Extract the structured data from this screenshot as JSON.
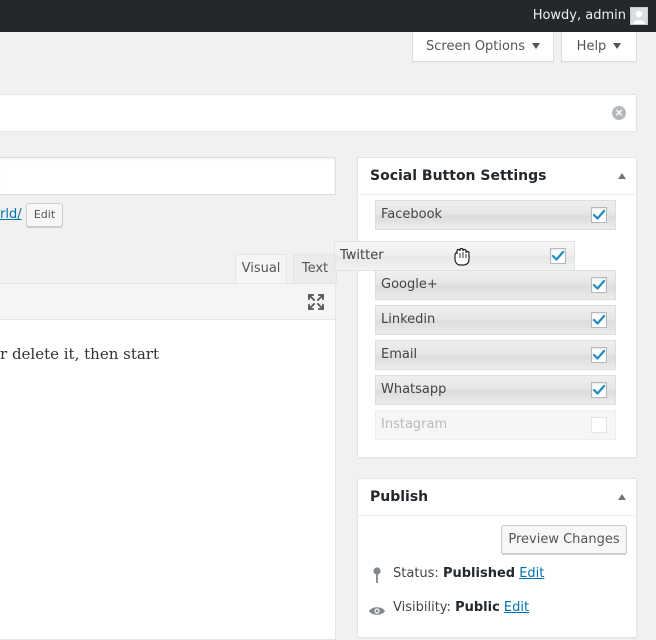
{
  "adminbar": {
    "howdy": "Howdy, admin"
  },
  "screen_meta": {
    "screen_options": "Screen Options",
    "help": "Help"
  },
  "notice": {
    "close_icon": "×"
  },
  "permalink": {
    "tail": "rld/",
    "edit_label": "Edit"
  },
  "editor": {
    "tabs": {
      "visual": "Visual",
      "text": "Text"
    },
    "content_fragment": "r delete it, then start"
  },
  "social_settings": {
    "title": "Social Button Settings",
    "items": [
      {
        "label": "Facebook",
        "checked": true,
        "enabled": true
      },
      {
        "label": "Twitter",
        "checked": true,
        "enabled": true,
        "dragging": true
      },
      {
        "label": "Google+",
        "checked": true,
        "enabled": true
      },
      {
        "label": "Linkedin",
        "checked": true,
        "enabled": true
      },
      {
        "label": "Email",
        "checked": true,
        "enabled": true
      },
      {
        "label": "Whatsapp",
        "checked": true,
        "enabled": true
      },
      {
        "label": "Instagram",
        "checked": false,
        "enabled": false
      }
    ]
  },
  "publish": {
    "title": "Publish",
    "preview_label": "Preview Changes",
    "status_label": "Status:",
    "status_value": "Published",
    "visibility_label": "Visibility:",
    "visibility_value": "Public",
    "edit_label": "Edit"
  },
  "colors": {
    "adminbar_bg": "#23282d",
    "link": "#0073aa",
    "check": "#1e8cbe"
  }
}
